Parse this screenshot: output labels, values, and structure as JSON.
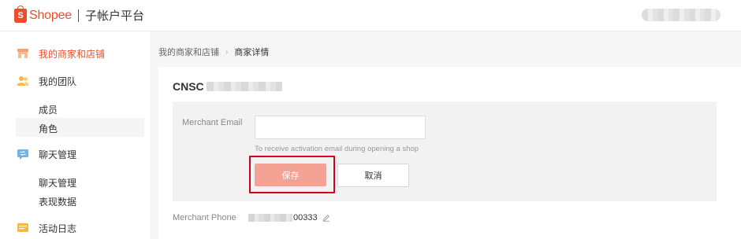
{
  "header": {
    "brand": "Shopee",
    "brand_glyph": "S",
    "subtitle": "子帐户平台"
  },
  "sidebar": {
    "items": [
      {
        "label": "我的商家和店铺",
        "icon": "store-icon",
        "active": true
      },
      {
        "label": "我的团队",
        "icon": "team-icon",
        "active": false,
        "children": [
          {
            "label": "成员"
          },
          {
            "label": "角色",
            "selected": true
          }
        ]
      },
      {
        "label": "聊天管理",
        "icon": "chat-icon",
        "active": false,
        "children": [
          {
            "label": "聊天管理"
          },
          {
            "label": "表现数据"
          }
        ]
      },
      {
        "label": "活动日志",
        "icon": "log-icon",
        "active": false
      }
    ]
  },
  "breadcrumb": {
    "parent": "我的商家和店铺",
    "current": "商家详情"
  },
  "merchant": {
    "title_prefix": "CNSC",
    "email_label": "Merchant Email",
    "email_value": "",
    "email_hint": "To receive activation email during opening a shop",
    "save_label": "保存",
    "cancel_label": "取消",
    "phone_label": "Merchant Phone",
    "phone_suffix": "00333"
  },
  "colors": {
    "accent": "#ee4d2d",
    "save_button": "#f3a293",
    "highlight": "#d0021b"
  }
}
